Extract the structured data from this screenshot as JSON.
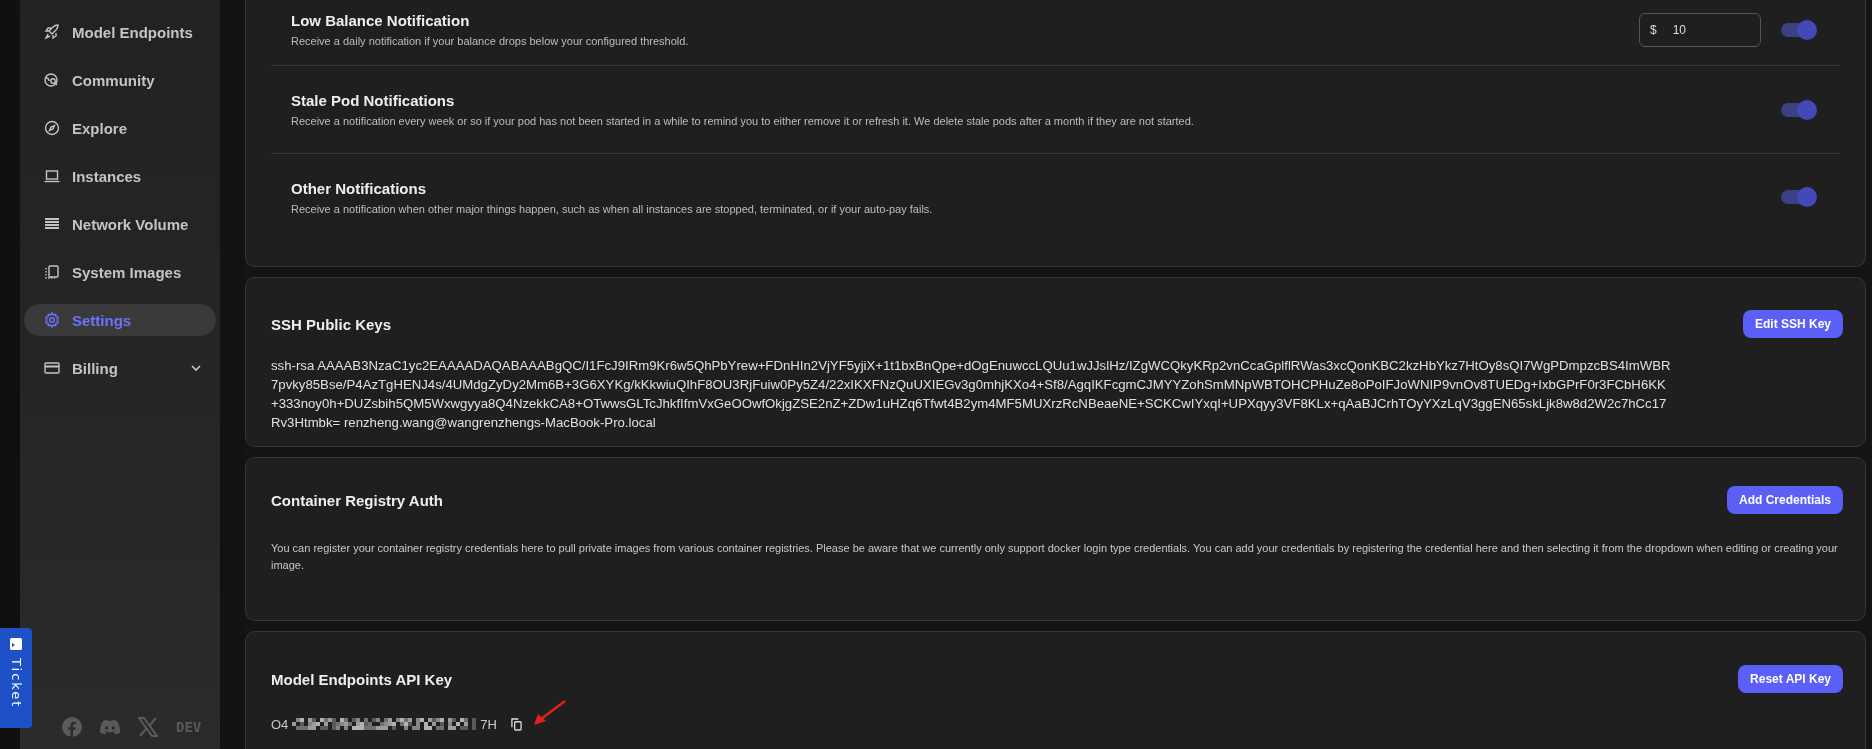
{
  "sidebar": {
    "items": [
      {
        "label": "Model Endpoints",
        "kind": "link",
        "selected": false
      },
      {
        "label": "Community",
        "kind": "link",
        "selected": false
      },
      {
        "label": "Explore",
        "kind": "link",
        "selected": false
      },
      {
        "label": "Instances",
        "kind": "link",
        "selected": false
      },
      {
        "label": "Network Volume",
        "kind": "link",
        "selected": false
      },
      {
        "label": "System Images",
        "kind": "link",
        "selected": false
      },
      {
        "label": "Settings",
        "kind": "link",
        "selected": true
      },
      {
        "label": "Billing",
        "kind": "group",
        "selected": false,
        "expanded": false
      }
    ]
  },
  "ticket": {
    "label": "Ticket"
  },
  "social": [
    {
      "kind": "facebook"
    },
    {
      "kind": "discord"
    },
    {
      "kind": "x"
    },
    {
      "kind": "dev",
      "label": "DEV"
    }
  ],
  "notifications": [
    {
      "title": "Low Balance Notification",
      "description": "Receive a daily notification if your balance drops below your configured threshold.",
      "threshold": {
        "prefix": "$",
        "value": "10"
      },
      "on": true
    },
    {
      "title": "Stale Pod Notifications",
      "description": "Receive a notification every week or so if your pod has not been started in a while to remind you to either remove it or refresh it. We delete stale pods after a month if they are not started.",
      "on": true
    },
    {
      "title": "Other Notifications",
      "description": "Receive a notification when other major things happen, such as when all instances are stopped, terminated, or if your auto-pay fails.",
      "on": true
    }
  ],
  "ssh_keys": {
    "title": "SSH Public Keys",
    "button": "Edit SSH Key",
    "key": "ssh-rsa AAAAB3NzaC1yc2EAAAADAQABAAABgQC/I1FcJ9IRm9Kr6w5QhPbYrew+FDnHIn2VjYF5yjiX+1t1bxBnQpe+dOgEnuwccLQUu1wJJslHz/IZgWCQkyKRp2vnCcaGplflRWas3xcQonKBC2kzHbYkz7HtOy8sQI7WgPDmpzcBS4ImWBR7pvky85Bse/P4AzTgHENJ4s/4UMdgZyDy2Mm6B+3G6XYKg/kKkwiuQIhF8OU3RjFuiw0Py5Z4/22xIKXFNzQuUXIEGv3g0mhjKXo4+Sf8/AgqIKFcgmCJMYYZohSmMNpWBTOHCPHuZe8oPoIFJoWNIP9vnOv8TUEDg+IxbGPrF0r3FCbH6KK+333noy0h+DUZsbih5QM5Wxwgyya8Q4NzekkCA8+OTwwsGLTcJhkfIfmVxGeOOwfOkjgZSE2nZ+ZDw1uHZq6Tfwt4B2ym4MF5MUXrzRcNBeaeNE+SCKCwIYxqI+UPXqyy3VF8KLx+qAaBJCrhTOyYXzLqV3ggEN65skLjk8w8d2W2c7hCc17Rv3Htmbk= renzheng.wang@wangrenzhengs-MacBook-Pro.local"
  },
  "container_registry": {
    "title": "Container Registry Auth",
    "button": "Add Credentials",
    "description": "You can register your container registry credentials here to pull private images from various container registries. Please be aware that we currently only support docker login type credentials. You can add your credentials by registering the credential here and then selecting it from the dropdown when editing or creating your image."
  },
  "api_key": {
    "title": "Model Endpoints API Key",
    "button": "Reset API Key",
    "key_start": "O4",
    "key_end": "7H"
  }
}
